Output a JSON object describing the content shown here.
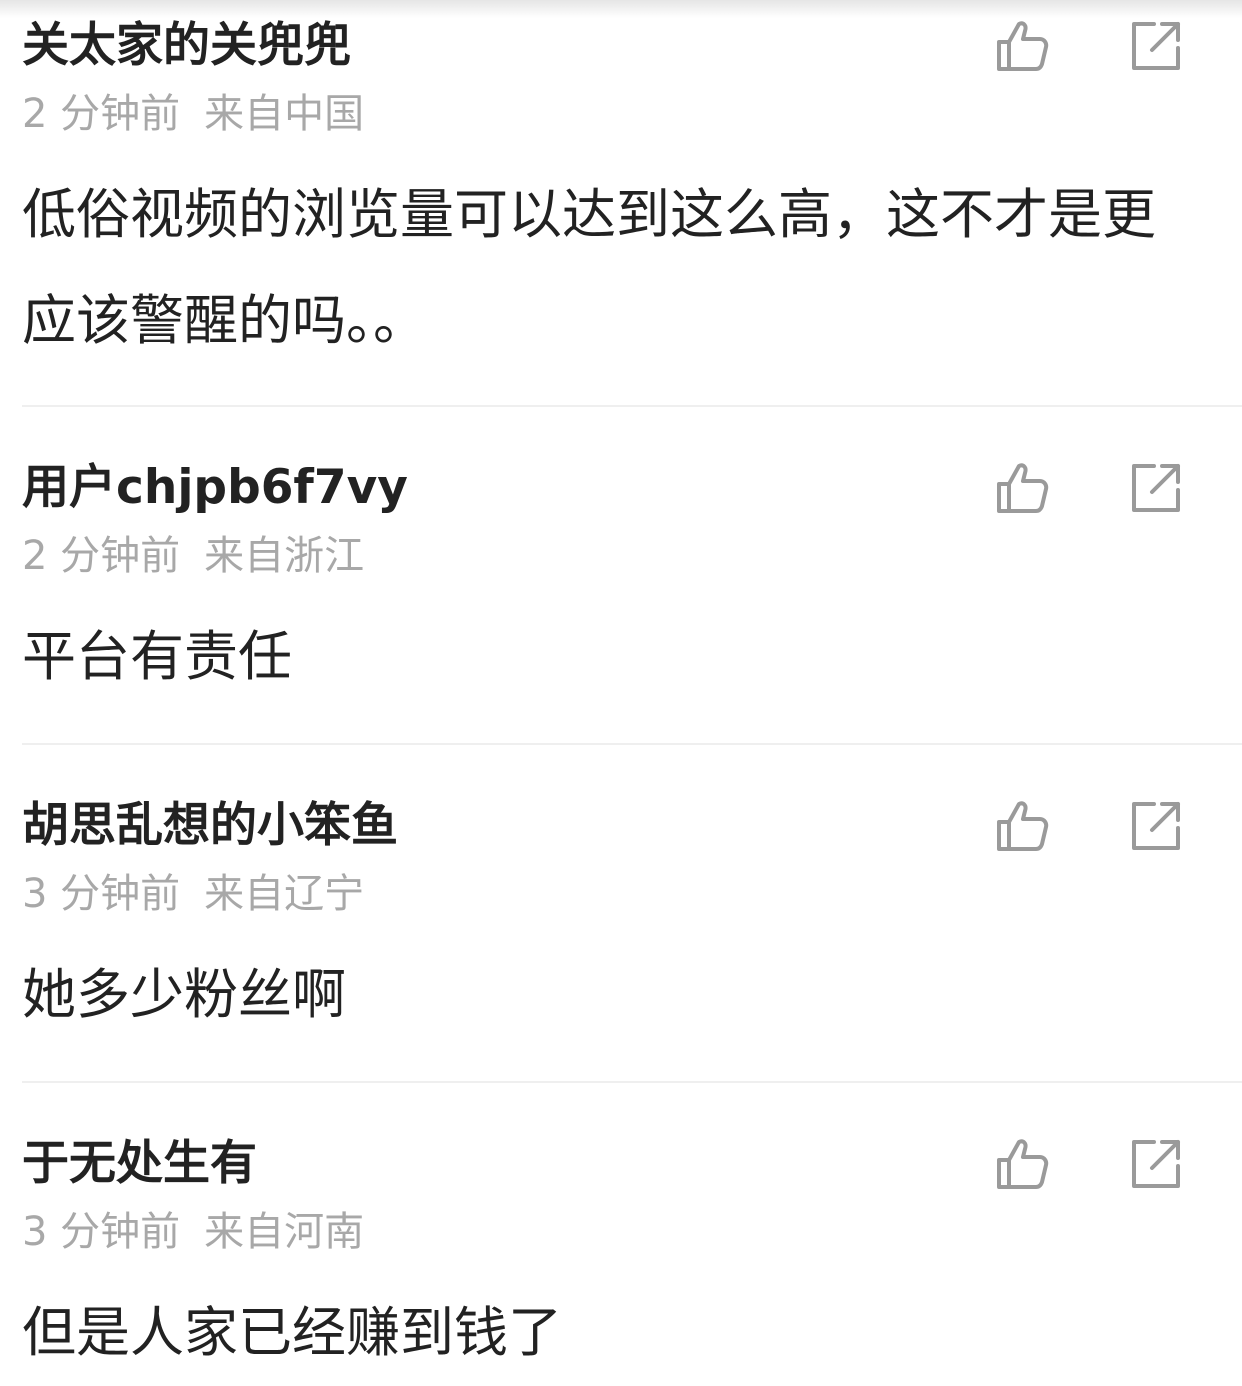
{
  "comments": [
    {
      "author": "关太家的关兜兜",
      "time": "2 分钟前",
      "location": "来自中国",
      "text": "低俗视频的浏览量可以达到这么高，这不才是更应该警醒的吗。。"
    },
    {
      "author": "用户chjpb6f7vy",
      "time": "2 分钟前",
      "location": "来自浙江",
      "text": "平台有责任"
    },
    {
      "author": "胡思乱想的小笨鱼",
      "time": "3 分钟前",
      "location": "来自辽宁",
      "text": "她多少粉丝啊"
    },
    {
      "author": "于无处生有",
      "time": "3 分钟前",
      "location": "来自河南",
      "text": "但是人家已经赚到钱了"
    }
  ],
  "icons": {
    "like": "thumbs-up-icon",
    "share": "share-icon"
  },
  "colors": {
    "author": "#222222",
    "meta": "#a8a8a8",
    "icon": "#9a9a9a",
    "divider": "#efefef"
  }
}
